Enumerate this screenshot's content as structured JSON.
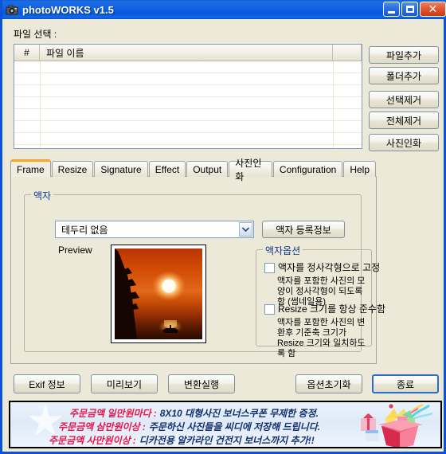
{
  "window": {
    "title": "photoWORKS v1.5",
    "icon": "camera-icon",
    "controls": {
      "minimize": "_",
      "maximize": "□",
      "close": "✕"
    }
  },
  "file_section": {
    "label": "파일 선택 :",
    "columns": [
      "#",
      "파일 이름",
      ""
    ],
    "rows": [],
    "buttons": [
      {
        "label": "파일추가"
      },
      {
        "label": "폴더추가"
      },
      {
        "label": "선택제거"
      },
      {
        "label": "전체제거"
      },
      {
        "label": "사진인화"
      }
    ]
  },
  "tabs": [
    {
      "label": "Frame",
      "active": true
    },
    {
      "label": "Resize",
      "active": false
    },
    {
      "label": "Signature",
      "active": false
    },
    {
      "label": "Effect",
      "active": false
    },
    {
      "label": "Output",
      "active": false
    },
    {
      "label": "사진인화",
      "active": false
    },
    {
      "label": "Configuration",
      "active": false
    },
    {
      "label": "Help",
      "active": false
    }
  ],
  "frame_tab": {
    "group_title": "액자",
    "frame_select": {
      "value": "테두리 없음",
      "placeholder": "테두리 없음"
    },
    "frame_info_button": "액자 등록정보",
    "preview_label": "Preview",
    "options_group": {
      "title": "액자옵션",
      "items": [
        {
          "label": "액자를 정사각형으로 고정",
          "checked": false,
          "description": "액자를 포함한 사진의 모양이 정사각형이 되도록 함 (썸네일용)"
        },
        {
          "label": "Resize 크기를 항상 준수함",
          "checked": false,
          "description": "액자를 포함한 사진의 변환후 기준축 크기가 Resize 크기와 일치하도록 함"
        }
      ]
    }
  },
  "bottom_buttons": [
    {
      "label": "Exif 정보"
    },
    {
      "label": "미리보기"
    },
    {
      "label": "변환실행"
    },
    {
      "label": "옵션초기화"
    },
    {
      "label": "종료",
      "focused": true
    }
  ],
  "banner": {
    "lines": [
      {
        "key": "주문금액 일만원마다",
        "sep": ":",
        "value": "8X10 대형사진 보너스쿠폰 무제한 증정."
      },
      {
        "key": "주문금액 삼만원이상",
        "sep": ":",
        "value": "주문하신 사진들을 씨디에 저장해 드립니다."
      },
      {
        "key": "주문금액 사만원이상",
        "sep": ":",
        "value": "디카전용 알카라인 건전지 보너스까지 추가!!"
      }
    ],
    "graphic": "gift-box-icon"
  },
  "colors": {
    "titlebar_blue": "#0a52d6",
    "window_face": "#ece9d8",
    "accent_orange": "#f5a623",
    "group_label_blue": "#113a8c",
    "banner_key_red": "#e8174a",
    "banner_value_navy": "#14306e",
    "focus_blue": "#2a6cd6"
  }
}
